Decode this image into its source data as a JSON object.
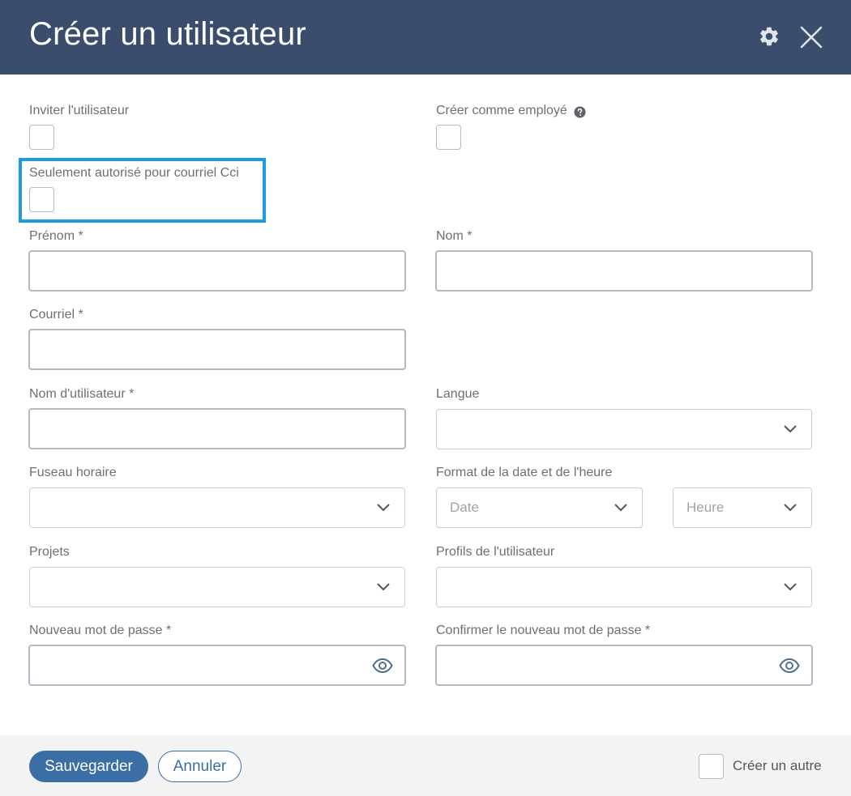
{
  "dialog": {
    "title": "Créer un utilisateur",
    "settings_icon": "gear-icon",
    "close_icon": "close-icon"
  },
  "form": {
    "invite_user_label": "Inviter l'utilisateur",
    "create_as_employee_label": "Créer comme employé",
    "bcc_only_label": "Seulement autorisé pour courriel Cci",
    "first_name_label": "Prénom *",
    "last_name_label": "Nom *",
    "email_label": "Courriel *",
    "username_label": "Nom d'utilisateur *",
    "language_label": "Langue",
    "timezone_label": "Fuseau horaire",
    "datetime_format_label": "Format de la date et de l'heure",
    "date_placeholder": "Date",
    "time_placeholder": "Heure",
    "projects_label": "Projets",
    "user_profiles_label": "Profils de l'utilisateur",
    "new_password_label": "Nouveau mot de passe *",
    "confirm_password_label": "Confirmer le nouveau mot de passe *"
  },
  "footer": {
    "save_label": "Sauvegarder",
    "cancel_label": "Annuler",
    "create_another_label": "Créer un autre"
  }
}
